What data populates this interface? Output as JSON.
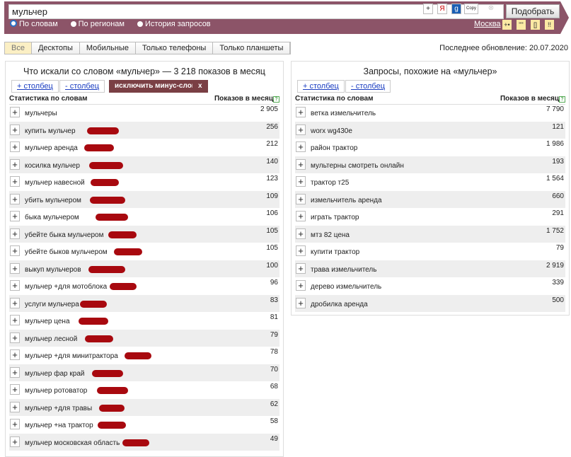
{
  "search": {
    "value": "мульчер",
    "submit": "Подобрать",
    "copy": "Copy"
  },
  "modes": [
    "По словам",
    "По регионам",
    "История запросов"
  ],
  "region": "Москва",
  "operators": [
    "+•",
    "\"\"",
    "[]",
    "!!"
  ],
  "devices": [
    "Все",
    "Десктопы",
    "Мобильные",
    "Только телефоны",
    "Только планшеты"
  ],
  "last_update": "Последнее обновление: 20.07.2020",
  "left": {
    "title": "Что искали со словом «мульчер» — 3 218 показов в месяц",
    "add_col": "+ столбец",
    "rm_col": "- столбец",
    "exclude": "исключить минус-слова",
    "x": "x",
    "col1": "Статистика по словам",
    "col2": "Показов в месяц",
    "rows": [
      [
        "мульчеры",
        "2 905"
      ],
      [
        "купить мульчер",
        "256"
      ],
      [
        "мульчер аренда",
        "212"
      ],
      [
        "косилка мульчер",
        "140"
      ],
      [
        "мульчер навесной",
        "123"
      ],
      [
        "убить мульчером",
        "109"
      ],
      [
        "быка мульчером",
        "106"
      ],
      [
        "убейте быка мульчером",
        "105"
      ],
      [
        "убейте быков мульчером",
        "105"
      ],
      [
        "выкуп мульчеров",
        "100"
      ],
      [
        "мульчер +для мотоблока",
        "96"
      ],
      [
        "услуги мульчера",
        "83"
      ],
      [
        "мульчер цена",
        "81"
      ],
      [
        "мульчер лесной",
        "79"
      ],
      [
        "мульчер +для минитрактора",
        "78"
      ],
      [
        "мульчер фар край",
        "70"
      ],
      [
        "мульчер ротоватор",
        "68"
      ],
      [
        "мульчер +для травы",
        "62"
      ],
      [
        "мульчер +на трактор",
        "58"
      ],
      [
        "мульчер московская область",
        "49"
      ]
    ]
  },
  "right": {
    "title": "Запросы, похожие на «мульчер»",
    "add_col": "+ столбец",
    "rm_col": "- столбец",
    "col1": "Статистика по словам",
    "col2": "Показов в месяц",
    "rows": [
      [
        "ветка измельчитель",
        "7 790"
      ],
      [
        "worx wg430e",
        "121"
      ],
      [
        "район трактор",
        "1 986"
      ],
      [
        "мультерны смотреть онлайн",
        "193"
      ],
      [
        "трактор т25",
        "1 564"
      ],
      [
        "измельчитель аренда",
        "660"
      ],
      [
        "играть трактор",
        "291"
      ],
      [
        "мтз 82 цена",
        "1 752"
      ],
      [
        "купити трактор",
        "79"
      ],
      [
        "трава измельчитель",
        "2 919"
      ],
      [
        "дерево измельчитель",
        "339"
      ],
      [
        "дробилка аренда",
        "500"
      ]
    ]
  }
}
